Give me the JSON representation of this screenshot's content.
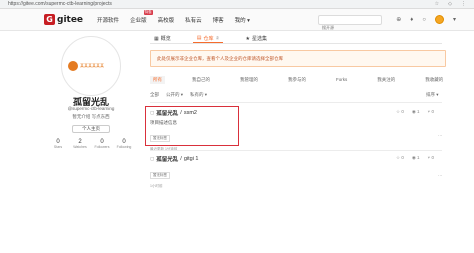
{
  "browser": {
    "url": "https://gitee.com/supermc-ctb-learning/projects"
  },
  "nav": {
    "logo_letter": "G",
    "logo_text": "gitee",
    "links": [
      {
        "label": "开源软件"
      },
      {
        "label": "企业版",
        "badge": "特惠"
      },
      {
        "label": "高校版"
      },
      {
        "label": "私有云"
      },
      {
        "label": "博客"
      },
      {
        "label": "我的 ▾"
      }
    ],
    "search_placeholder": "搜开源"
  },
  "profile": {
    "avatar_text": "某某某某某某",
    "name": "孤留光乱",
    "handle": "@supermc-ctb-learning",
    "note": "暂无介绍 写点东西",
    "personal_button": "个人主页",
    "stats": [
      {
        "num": "0",
        "label": "Stars"
      },
      {
        "num": "2",
        "label": "Watches"
      },
      {
        "num": "0",
        "label": "Followers"
      },
      {
        "num": "0",
        "label": "Following"
      }
    ]
  },
  "tabs": [
    {
      "label": "概览",
      "count": ""
    },
    {
      "label": "仓库",
      "count": "2"
    },
    {
      "label": "星选集",
      "count": ""
    }
  ],
  "notice": "此处仅展示非企业仓库，查看个人及企业的仓库请选择全部仓库",
  "filters": [
    "所有",
    "我自己的",
    "我管理的",
    "我参与的",
    "Forks",
    "我关注的",
    "我收藏的"
  ],
  "search_row": [
    "全部",
    "公开的 ▾",
    "私有的 ▾"
  ],
  "sort": "排序 ▾",
  "repos": [
    {
      "owner": "孤留光乱",
      "name": "ssm2",
      "desc": "项目描述信息",
      "tag": "暂无标签",
      "meta": "最近更新 1分钟前",
      "stars": "0",
      "watches": "1",
      "forks": "0",
      "more": "⋯"
    },
    {
      "owner": "孤留光乱",
      "name": "gitgi 1",
      "desc": "",
      "tag": "暂无标签",
      "meta": "1小时前",
      "stars": "0",
      "watches": "1",
      "forks": "0",
      "more": "⋯"
    }
  ],
  "colors": {
    "brand": "#c71d23",
    "accent": "#f56c2d",
    "highlight": "#d9303b"
  }
}
